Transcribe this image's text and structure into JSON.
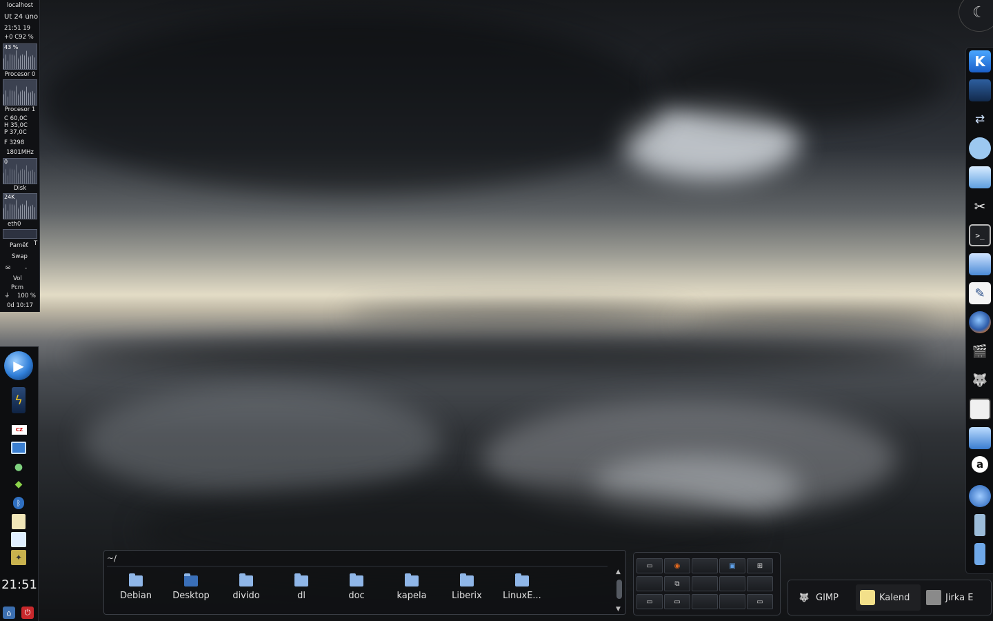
{
  "sysmon": {
    "host": "localhost",
    "date_line": "Út 24 úno",
    "time_line": "21:51 19",
    "temp_line": "+0 C92 %",
    "cpu0_pct": "43 %",
    "cpu0_label": "Procesor 0",
    "cpu1_label": "Procesor 1",
    "temp_c": "C    60,0C",
    "temp_h": "H    35,0C",
    "temp_p": "P    37,0C",
    "fan": "F      3298",
    "freq": "1801MHz",
    "disk_zero": "0",
    "disk_label": "Disk",
    "net_rate": "24K",
    "net_label": "eth0",
    "ram_label": "Paměť",
    "ram_t": "T",
    "swap_label": "Swap",
    "mail_label": "-",
    "vol_label": "Vol",
    "pcm_label": "Pcm",
    "battery": "100 %",
    "uptime": "0d 10:17"
  },
  "leftpanel": {
    "clock": "21:51",
    "icons": [
      "media-player-icon",
      "battery-icon",
      "keyboard-layout-cz-icon",
      "display-icon",
      "chat-icon",
      "network-icon",
      "bluetooth-icon",
      "clipboard-icon",
      "notes-icon",
      "kwallet-icon",
      "lock-screen-icon",
      "shutdown-icon"
    ],
    "kbd_layout": "CZ"
  },
  "rightpanel": {
    "icons": [
      "kde-menu-icon",
      "desktop-icon",
      "network-manager-icon",
      "system-monitor-icon",
      "file-manager-icon",
      "settings-tools-icon",
      "terminal-icon",
      "text-editor-icon",
      "write-icon",
      "firefox-icon",
      "video-editor-icon",
      "gimp-icon",
      "photo-viewer-icon",
      "remote-desktop-icon",
      "amarok-icon",
      "thunderbird-icon",
      "phone-icon",
      "usb-device-icon"
    ],
    "kde_glyph": "K"
  },
  "folderview": {
    "path": "~/",
    "items": [
      "Debian",
      "Desktop",
      "divido",
      "dl",
      "doc",
      "kapela",
      "Liberix",
      "LinuxE..."
    ]
  },
  "taskbar": {
    "tasks": [
      "GIMP",
      "Kalend",
      "Jirka E"
    ]
  },
  "colors": {
    "folder_blue": "#8fb6e8",
    "panel_bg": "#0d0e10",
    "accent_blue": "#2f7ed8"
  }
}
